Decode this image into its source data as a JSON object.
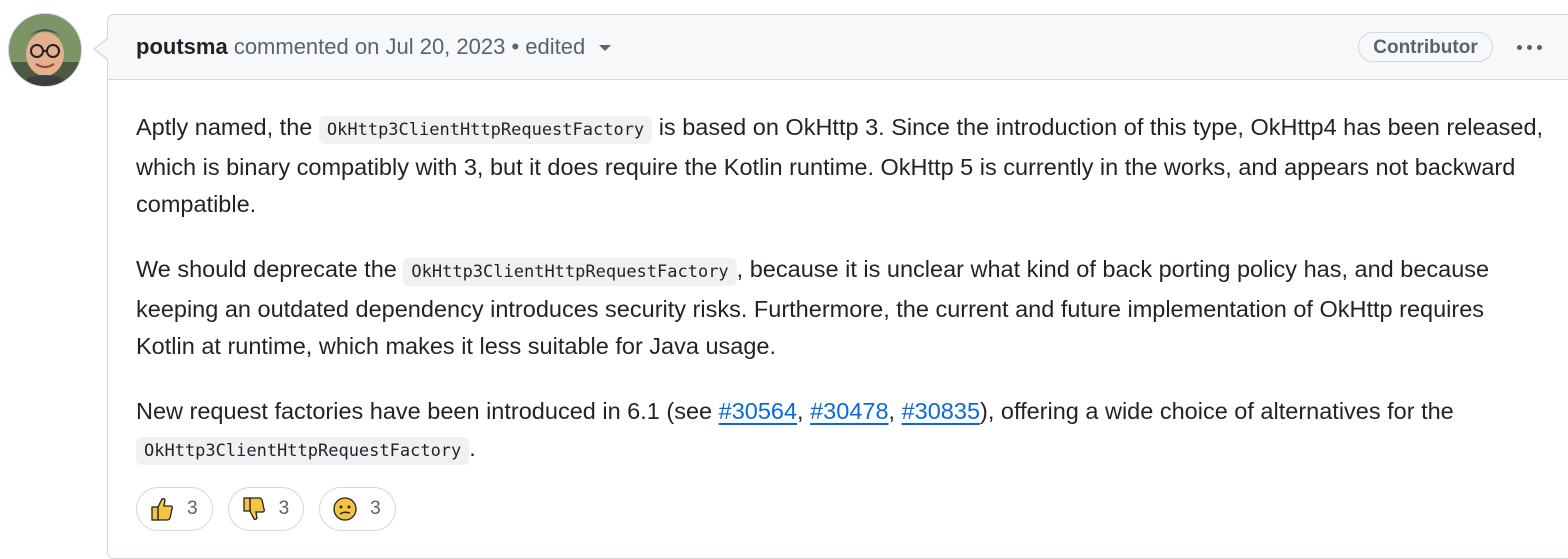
{
  "comment": {
    "author": "poutsma",
    "action": "commented on",
    "date": "Jul 20, 2023",
    "separator": "•",
    "edited_label": "edited",
    "role_badge": "Contributor",
    "paragraphs": [
      {
        "t1": "Aptly named, the ",
        "code1": "OkHttp3ClientHttpRequestFactory",
        "t2": " is based on OkHttp 3. Since the introduction of this type, OkHttp4 has been released, which is binary compatibly with 3, but it does require the Kotlin runtime. OkHttp 5 is currently in the works, and appears not backward compatible."
      },
      {
        "t1": "We should deprecate the ",
        "code1": "OkHttp3ClientHttpRequestFactory",
        "t2": ", because it is unclear what kind of back porting policy has, and because keeping an outdated dependency introduces security risks. Furthermore, the current and future implementation of OkHttp requires Kotlin at runtime, which makes it less suitable for Java usage."
      },
      {
        "t1": "New request factories have been introduced in 6.1 (see ",
        "link1": "#30564",
        "sep1": ", ",
        "link2": "#30478",
        "sep2": ", ",
        "link3": "#30835",
        "t2": "), offering a wide choice of alternatives for the ",
        "code1": "OkHttp3ClientHttpRequestFactory",
        "t3": "."
      }
    ],
    "reactions": [
      {
        "icon": "thumbs-up-icon",
        "count": "3"
      },
      {
        "icon": "thumbs-down-icon",
        "count": "3"
      },
      {
        "icon": "confused-face-icon",
        "count": "3"
      }
    ]
  },
  "colors": {
    "link": "#0969da",
    "header_bg": "#f6f8fa",
    "border": "#d0d7de",
    "emoji": "#f5c542"
  }
}
